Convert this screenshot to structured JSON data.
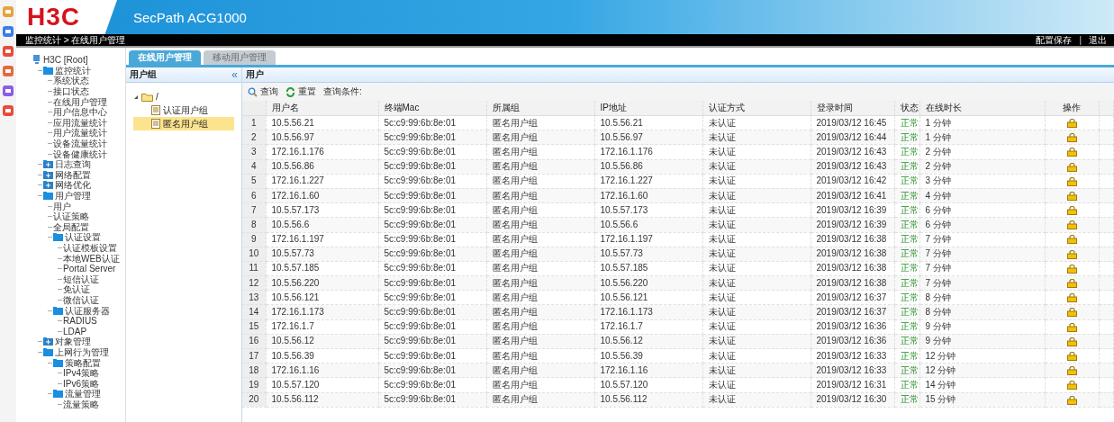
{
  "header": {
    "logo": "H3C",
    "product": "SecPath ACG1000"
  },
  "breadcrumb": "监控统计 > 在线用户管理",
  "top_links": [
    "配置保存",
    "退出"
  ],
  "top_link_separator": "|",
  "nav": {
    "root": "H3C [Root]",
    "items": [
      {
        "label": "监控统计",
        "expanded": true,
        "children": [
          {
            "label": "系统状态"
          },
          {
            "label": "接口状态"
          },
          {
            "label": "在线用户管理"
          },
          {
            "label": "用户信息中心"
          },
          {
            "label": "应用流量统计"
          },
          {
            "label": "用户流量统计"
          },
          {
            "label": "设备流量统计"
          },
          {
            "label": "设备健康统计"
          }
        ]
      },
      {
        "label": "日志查询",
        "expanded": false
      },
      {
        "label": "网络配置",
        "expanded": false
      },
      {
        "label": "网络优化",
        "expanded": false
      },
      {
        "label": "用户管理",
        "expanded": true,
        "children": [
          {
            "label": "用户"
          },
          {
            "label": "认证策略"
          },
          {
            "label": "全局配置"
          },
          {
            "label": "认证设置",
            "expanded": true,
            "children": [
              {
                "label": "认证模板设置"
              },
              {
                "label": "本地WEB认证"
              },
              {
                "label": "Portal Server"
              },
              {
                "label": "短信认证"
              },
              {
                "label": "免认证"
              },
              {
                "label": "微信认证"
              }
            ]
          },
          {
            "label": "认证服务器",
            "expanded": true,
            "children": [
              {
                "label": "RADIUS"
              },
              {
                "label": "LDAP"
              }
            ]
          }
        ]
      },
      {
        "label": "对象管理",
        "expanded": false
      },
      {
        "label": "上网行为管理",
        "expanded": true,
        "children": [
          {
            "label": "策略配置",
            "expanded": true,
            "children": [
              {
                "label": "IPv4策略"
              },
              {
                "label": "IPv6策略"
              }
            ]
          },
          {
            "label": "流量管理",
            "expanded": true,
            "children": [
              {
                "label": "流量策略"
              }
            ]
          }
        ]
      }
    ]
  },
  "tabs": [
    {
      "label": "在线用户管理",
      "selected": true
    },
    {
      "label": "移动用户管理",
      "selected": false
    }
  ],
  "group_panel": {
    "title": "用户组",
    "collapse": "«",
    "root": "/",
    "root_expanded": true,
    "groups": [
      {
        "label": "认证用户组",
        "selected": false
      },
      {
        "label": "匿名用户组",
        "selected": true
      }
    ]
  },
  "user_panel": {
    "title": "用户",
    "toolbar": [
      "查询",
      "重置"
    ],
    "condition": "查询条件:"
  },
  "table": {
    "columns": [
      "",
      "用户名",
      "终端Mac",
      "所属组",
      "IP地址",
      "认证方式",
      "登录时间",
      "状态",
      "在线时长",
      "操作"
    ],
    "rows": [
      [
        "1",
        "10.5.56.21",
        "5c:c9:99:6b:8e:01",
        "匿名用户组",
        "10.5.56.21",
        "未认证",
        "2019/03/12 16:45",
        "正常",
        "1 分钟"
      ],
      [
        "2",
        "10.5.56.97",
        "5c:c9:99:6b:8e:01",
        "匿名用户组",
        "10.5.56.97",
        "未认证",
        "2019/03/12 16:44",
        "正常",
        "1 分钟"
      ],
      [
        "3",
        "172.16.1.176",
        "5c:c9:99:6b:8e:01",
        "匿名用户组",
        "172.16.1.176",
        "未认证",
        "2019/03/12 16:43",
        "正常",
        "2 分钟"
      ],
      [
        "4",
        "10.5.56.86",
        "5c:c9:99:6b:8e:01",
        "匿名用户组",
        "10.5.56.86",
        "未认证",
        "2019/03/12 16:43",
        "正常",
        "2 分钟"
      ],
      [
        "5",
        "172.16.1.227",
        "5c:c9:99:6b:8e:01",
        "匿名用户组",
        "172.16.1.227",
        "未认证",
        "2019/03/12 16:42",
        "正常",
        "3 分钟"
      ],
      [
        "6",
        "172.16.1.60",
        "5c:c9:99:6b:8e:01",
        "匿名用户组",
        "172.16.1.60",
        "未认证",
        "2019/03/12 16:41",
        "正常",
        "4 分钟"
      ],
      [
        "7",
        "10.5.57.173",
        "5c:c9:99:6b:8e:01",
        "匿名用户组",
        "10.5.57.173",
        "未认证",
        "2019/03/12 16:39",
        "正常",
        "6 分钟"
      ],
      [
        "8",
        "10.5.56.6",
        "5c:c9:99:6b:8e:01",
        "匿名用户组",
        "10.5.56.6",
        "未认证",
        "2019/03/12 16:39",
        "正常",
        "6 分钟"
      ],
      [
        "9",
        "172.16.1.197",
        "5c:c9:99:6b:8e:01",
        "匿名用户组",
        "172.16.1.197",
        "未认证",
        "2019/03/12 16:38",
        "正常",
        "7 分钟"
      ],
      [
        "10",
        "10.5.57.73",
        "5c:c9:99:6b:8e:01",
        "匿名用户组",
        "10.5.57.73",
        "未认证",
        "2019/03/12 16:38",
        "正常",
        "7 分钟"
      ],
      [
        "11",
        "10.5.57.185",
        "5c:c9:99:6b:8e:01",
        "匿名用户组",
        "10.5.57.185",
        "未认证",
        "2019/03/12 16:38",
        "正常",
        "7 分钟"
      ],
      [
        "12",
        "10.5.56.220",
        "5c:c9:99:6b:8e:01",
        "匿名用户组",
        "10.5.56.220",
        "未认证",
        "2019/03/12 16:38",
        "正常",
        "7 分钟"
      ],
      [
        "13",
        "10.5.56.121",
        "5c:c9:99:6b:8e:01",
        "匿名用户组",
        "10.5.56.121",
        "未认证",
        "2019/03/12 16:37",
        "正常",
        "8 分钟"
      ],
      [
        "14",
        "172.16.1.173",
        "5c:c9:99:6b:8e:01",
        "匿名用户组",
        "172.16.1.173",
        "未认证",
        "2019/03/12 16:37",
        "正常",
        "8 分钟"
      ],
      [
        "15",
        "172.16.1.7",
        "5c:c9:99:6b:8e:01",
        "匿名用户组",
        "172.16.1.7",
        "未认证",
        "2019/03/12 16:36",
        "正常",
        "9 分钟"
      ],
      [
        "16",
        "10.5.56.12",
        "5c:c9:99:6b:8e:01",
        "匿名用户组",
        "10.5.56.12",
        "未认证",
        "2019/03/12 16:36",
        "正常",
        "9 分钟"
      ],
      [
        "17",
        "10.5.56.39",
        "5c:c9:99:6b:8e:01",
        "匿名用户组",
        "10.5.56.39",
        "未认证",
        "2019/03/12 16:33",
        "正常",
        "12 分钟"
      ],
      [
        "18",
        "172.16.1.16",
        "5c:c9:99:6b:8e:01",
        "匿名用户组",
        "172.16.1.16",
        "未认证",
        "2019/03/12 16:33",
        "正常",
        "12 分钟"
      ],
      [
        "19",
        "10.5.57.120",
        "5c:c9:99:6b:8e:01",
        "匿名用户组",
        "10.5.57.120",
        "未认证",
        "2019/03/12 16:31",
        "正常",
        "14 分钟"
      ],
      [
        "20",
        "10.5.56.112",
        "5c:c9:99:6b:8e:01",
        "匿名用户组",
        "10.5.56.112",
        "未认证",
        "2019/03/12 16:30",
        "正常",
        "15 分钟"
      ]
    ]
  }
}
